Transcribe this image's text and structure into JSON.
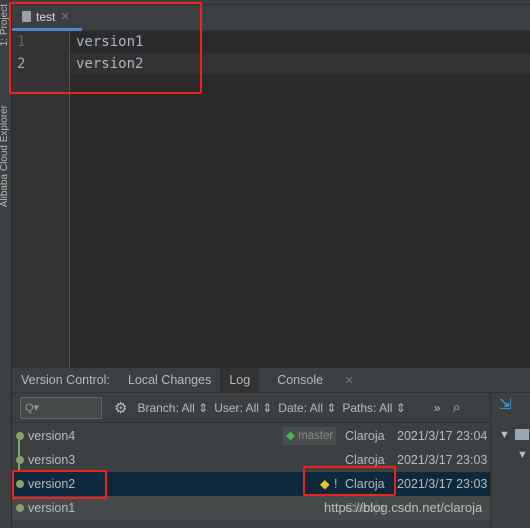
{
  "side_strip": {
    "project": "1: Project",
    "explorer": "Alibaba Cloud Explorer"
  },
  "editor": {
    "tab": "test",
    "lines": [
      {
        "num": "1",
        "text": "version1"
      },
      {
        "num": "2",
        "text": "version2"
      }
    ]
  },
  "panel": {
    "tabs": [
      "Version Control:",
      "Local Changes",
      "Log",
      "Console"
    ],
    "active_tab": "Log",
    "search_placeholder": "Q▾",
    "filters": [
      "Branch: All ⇕",
      "User: All ⇕",
      "Date: All ⇕",
      "Paths: All ⇕"
    ],
    "more": "»",
    "commits": [
      {
        "message": "version4",
        "branch": "master",
        "author": "Claroja",
        "date": "2021/3/17 23:04"
      },
      {
        "message": "version3",
        "author": "Claroja",
        "date": "2021/3/17 23:03"
      },
      {
        "message": "version2",
        "tag": "!",
        "author": "Claroja",
        "date": "2021/3/17 23:03",
        "selected": true
      },
      {
        "message": "version1",
        "author": "Claroja",
        "date": ""
      }
    ]
  },
  "watermark": "https://blog.csdn.net/claroja",
  "colors": {
    "accent": "#4a88c7",
    "selected_row": "#0d293e",
    "graph": "#88a06a",
    "highlight_box": "#f0221c",
    "branch_tag": "#3fb950",
    "tag_yellow": "#e8c42b"
  }
}
